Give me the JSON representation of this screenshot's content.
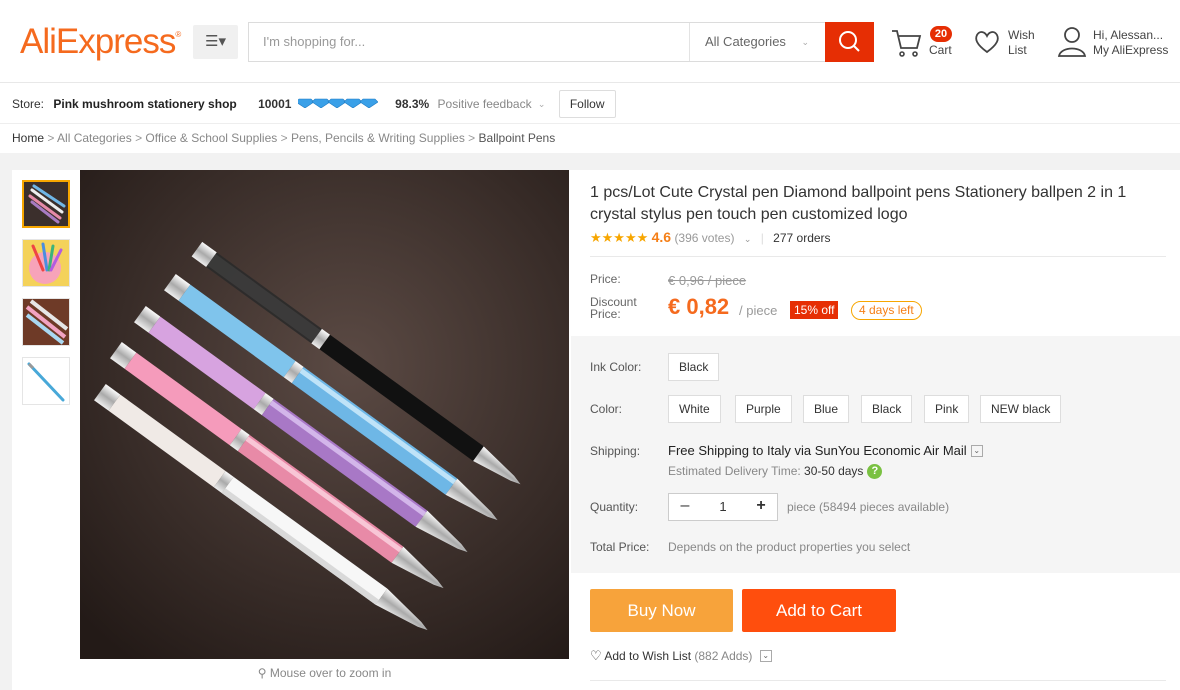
{
  "header": {
    "logo": "AliExpress",
    "logo_mark": "®",
    "menu_icon": "☰▾",
    "search_placeholder": "I'm shopping for...",
    "category_select": "All Categories",
    "cart_count": "20",
    "cart_label": "Cart",
    "wish_line1": "Wish",
    "wish_line2": "List",
    "account_line1": "Hi, Alessan...",
    "account_line2": "My AliExpress",
    "accent_color": "#e62e04",
    "brand_color": "#f56a1e"
  },
  "store": {
    "prefix": "Store:",
    "name": "Pink mushroom stationery shop",
    "score": "10001",
    "feedback_pct": "98.3%",
    "feedback_label": "Positive feedback",
    "follow_label": "Follow"
  },
  "breadcrumb": [
    "Home",
    "All Categories",
    "Office & School Supplies",
    "Pens, Pencils & Writing Supplies",
    "Ballpoint Pens"
  ],
  "gallery": {
    "zoom_hint": "Mouse over to zoom in",
    "thumbnail_count": 4
  },
  "product": {
    "title": "1 pcs/Lot Cute Crystal pen Diamond ballpoint pens Stationery ballpen 2 in 1 crystal stylus pen touch pen customized logo",
    "rating": "4.6",
    "votes": "(396 votes)",
    "orders": "277 orders",
    "price_label": "Price:",
    "original_price": "€ 0,96 / piece",
    "discount_label_1": "Discount",
    "discount_label_2": "Price:",
    "price": "€ 0,82",
    "unit": "/ piece",
    "off_badge": "15% off",
    "days_left": "4 days left"
  },
  "options": {
    "ink_label": "Ink Color:",
    "ink_options": [
      "Black"
    ],
    "color_label": "Color:",
    "color_options": [
      "White",
      "Purple",
      "Blue",
      "Black",
      "Pink",
      "NEW black"
    ],
    "shipping_label": "Shipping:",
    "shipping_text": "Free Shipping to Italy via SunYou Economic Air Mail",
    "delivery_label": "Estimated Delivery Time:",
    "delivery_days": "30-50 days",
    "quantity_label": "Quantity:",
    "quantity_value": "1",
    "quantity_minus": "–",
    "quantity_plus": "+",
    "availability": "piece (58494 pieces available)",
    "total_label": "Total Price:",
    "total_text": "Depends on the product properties you select"
  },
  "actions": {
    "buy_now": "Buy Now",
    "add_to_cart": "Add to Cart",
    "wishlist_label": "Add to Wish List",
    "wishlist_count": "(882 Adds)"
  }
}
